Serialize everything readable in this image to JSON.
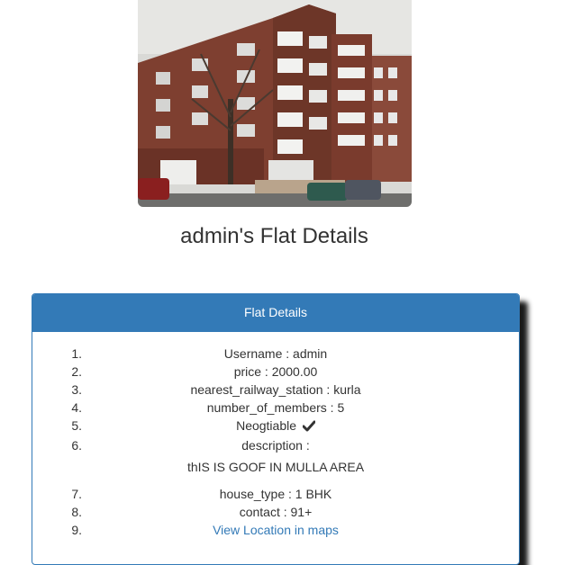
{
  "page": {
    "title": "admin's Flat Details"
  },
  "photo": {
    "icon": "building-photo"
  },
  "panel": {
    "heading": "Flat Details",
    "items": [
      {
        "num": "1.",
        "text": "Username : admin"
      },
      {
        "num": "2.",
        "text": "price : 2000.00"
      },
      {
        "num": "3.",
        "text": "nearest_railway_station : kurla"
      },
      {
        "num": "4.",
        "text": "number_of_members : 5"
      },
      {
        "num": "5.",
        "text": "Neogtiable",
        "icon": "check-icon"
      },
      {
        "num": "6.",
        "text": "description :",
        "extra": "thIS IS GOOF IN MULLA AREA"
      },
      {
        "num": "7.",
        "text": "house_type : 1 BHK"
      },
      {
        "num": "8.",
        "text": "contact : 91+"
      },
      {
        "num": "9.",
        "link": "View Location in maps"
      }
    ]
  },
  "colors": {
    "primary": "#337ab7",
    "text": "#333333"
  }
}
